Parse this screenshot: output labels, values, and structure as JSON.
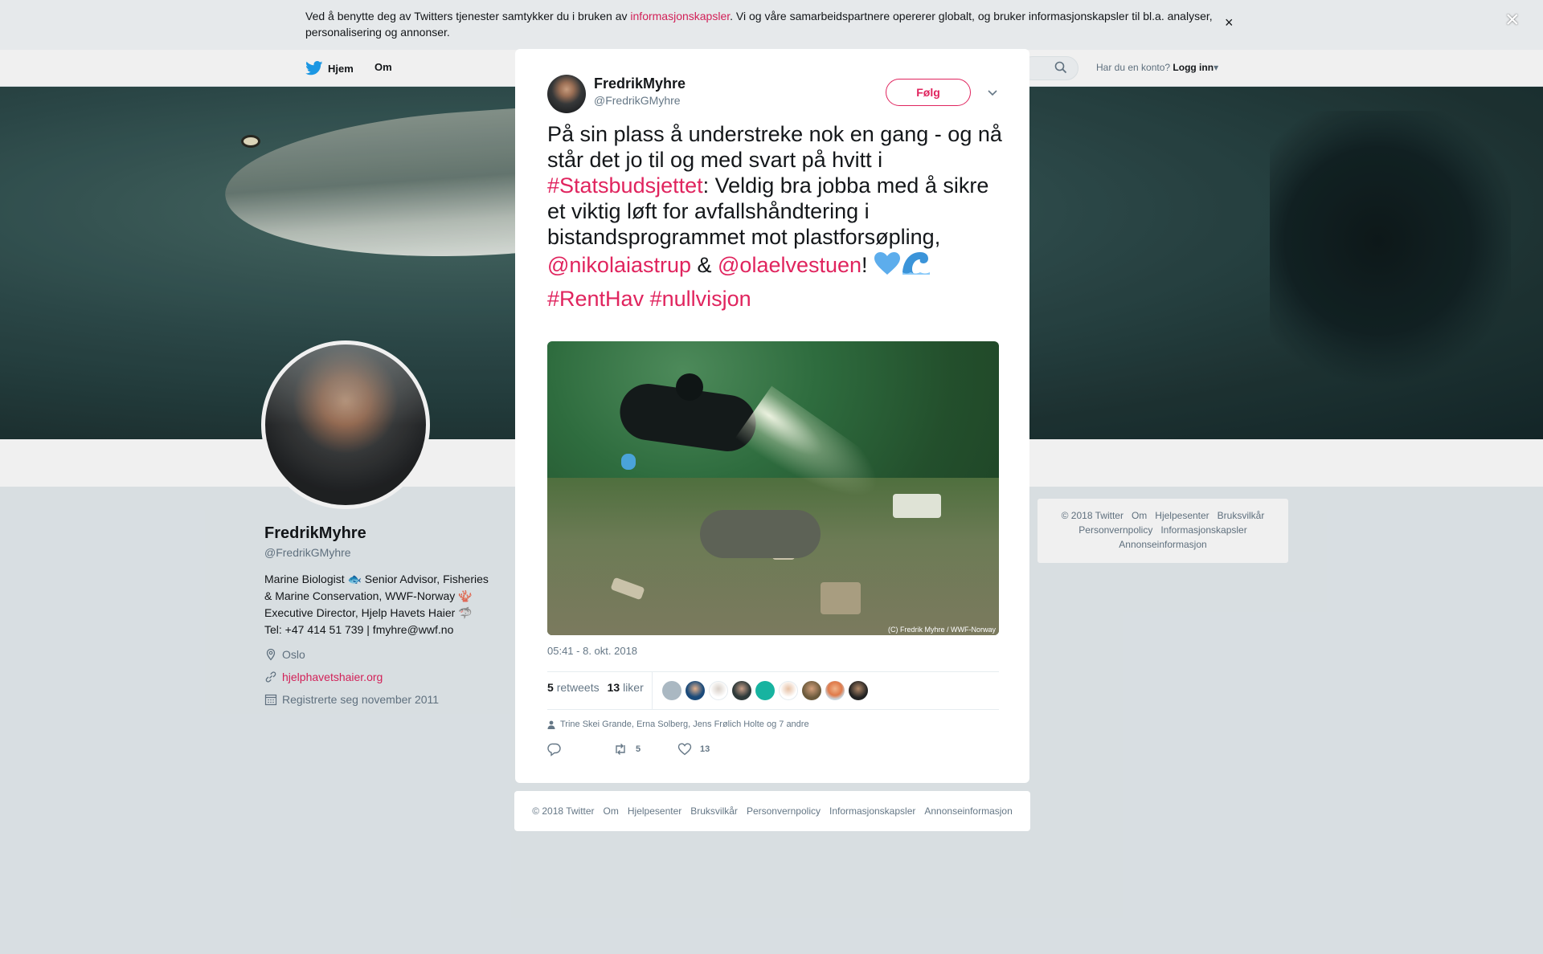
{
  "cookie": {
    "prefix": "Ved å benytte deg av Twitters tjenester samtykker du i bruken av ",
    "link": "informasjonskapsler",
    "suffix": ". Vi og våre samarbeidspartnere opererer globalt, og bruker informasjonskapsler til bl.a. analyser, personalisering og annonser.",
    "close": "×"
  },
  "nav": {
    "home": "Hjem",
    "about": "Om",
    "account_prompt": "Har du en konto?",
    "login": "Logg inn"
  },
  "profile": {
    "name": "FredrikMyhre",
    "handle": "@FredrikGMyhre",
    "bio_line1": "Marine Biologist 🐟 Senior Advisor, Fisheries",
    "bio_line2": "& Marine Conservation, WWF-Norway 🪸",
    "bio_line3": "Executive Director, Hjelp Havets Haier 🦈",
    "bio_line4": "Tel: +47 414 51 739 | fmyhre@wwf.no",
    "location": "Oslo",
    "website": "hjelphavetshaier.org",
    "joined": "Registrerte seg november 2011"
  },
  "side_footer": {
    "items": [
      "© 2018 Twitter",
      "Om",
      "Hjelpesenter",
      "Bruksvilkår",
      "Personvernpolicy",
      "Informasjonskapsler",
      "Annonseinformasjon"
    ]
  },
  "overlay": {
    "close": "×"
  },
  "tweet": {
    "author_name": "FredrikMyhre",
    "author_handle": "@FredrikGMyhre",
    "follow_label": "Følg",
    "text_part1": "På sin plass å understreke nok en gang - og nå står det jo til og med svart på hvitt i ",
    "hashtag1": "#Statsbudsjettet",
    "text_part2": ": Veldig bra jobba med å sikre et viktig løft for avfallshåndtering i bistandsprogrammet mot plastforsøpling, ",
    "mention1": "@nikolaiastrup",
    "amp": " & ",
    "mention2": "@olaelvestuen",
    "exclaim": "! ",
    "hashtag2": "#RentHav",
    "hashtag3": "#nullvisjon",
    "photo_credit": "(C) Fredrik Myhre / WWF-Norway",
    "timestamp": "05:41 - 8. okt. 2018",
    "retweets_count": "5",
    "retweets_label": "retweets",
    "likes_count": "13",
    "likes_label": "liker",
    "liked_by": "Trine Skei Grande, Erna Solberg, Jens Frølich Holte og 7 andre",
    "action_retweets": "5",
    "action_likes": "13"
  },
  "modal_footer": {
    "items": [
      "© 2018 Twitter",
      "Om",
      "Hjelpesenter",
      "Bruksvilkår",
      "Personvernpolicy",
      "Informasjonskapsler",
      "Annonseinformasjon"
    ]
  },
  "colors": {
    "accent": "#e0245e",
    "secondary_text": "#657786",
    "page_background": "#e6ecf0"
  },
  "icons": [
    "twitter-bird-icon",
    "search-icon",
    "location-icon",
    "link-icon",
    "calendar-icon",
    "close-icon",
    "chevron-down-icon",
    "blue-heart-emoji",
    "wave-emoji",
    "user-icon",
    "reply-icon",
    "retweet-icon",
    "like-icon"
  ]
}
